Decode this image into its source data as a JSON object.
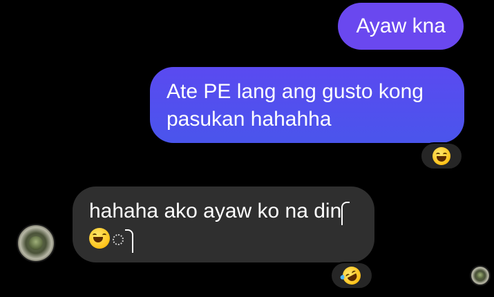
{
  "messages": [
    {
      "direction": "outgoing",
      "lines": [
        "Ayaw kna"
      ]
    },
    {
      "direction": "outgoing",
      "lines": [
        "Ate PE lang ang gusto kong",
        "pasukan hahahha"
      ],
      "reaction": "grinning-squinting-face"
    },
    {
      "direction": "incoming",
      "lines": [
        "hahaha ako ayaw ko na din"
      ],
      "reaction": "rolling-on-the-floor-laughing-face"
    }
  ],
  "colors": {
    "background": "#000000",
    "outgoing_bubble": "#5a4af0",
    "incoming_bubble": "#2f2f2f",
    "text": "#ffffff"
  }
}
